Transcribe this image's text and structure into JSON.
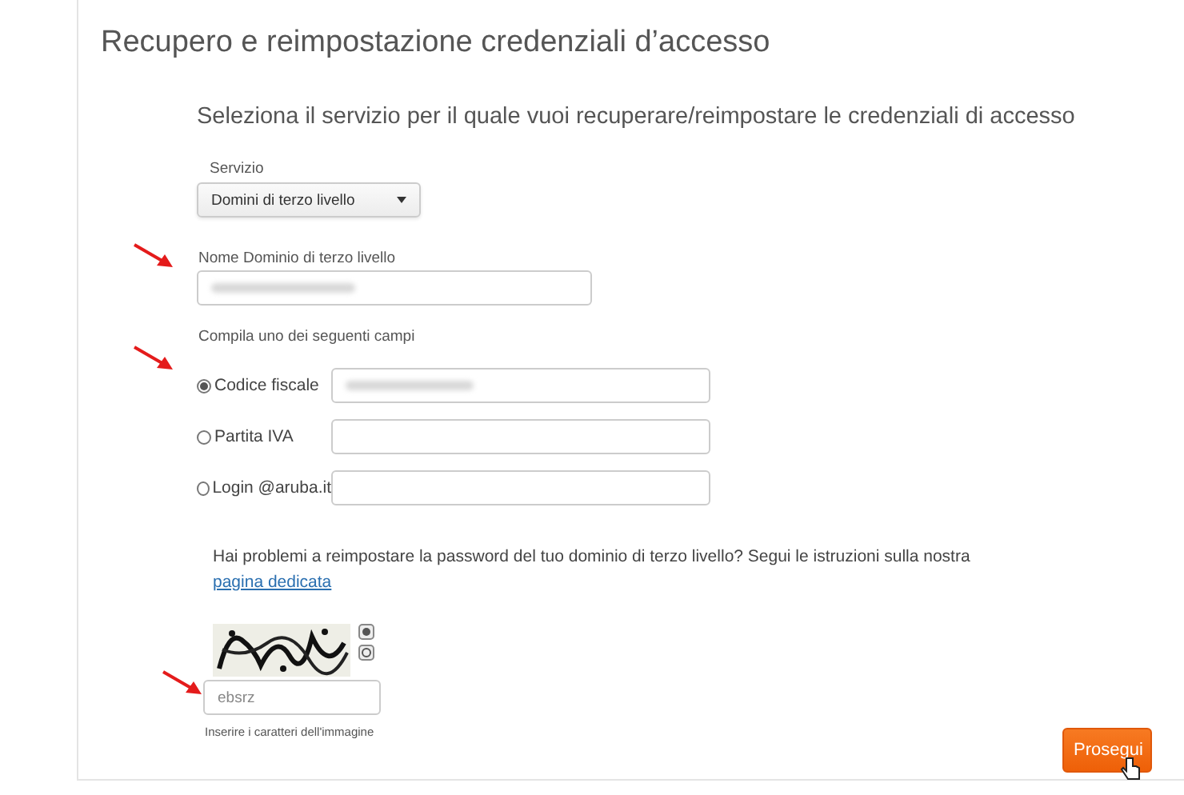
{
  "title": "Recupero e reimpostazione credenziali d’accesso",
  "subtitle": "Seleziona il servizio per il quale vuoi recuperare/reimpostare le credenziali di accesso",
  "service": {
    "label": "Servizio",
    "value": "Domini di terzo livello"
  },
  "domain_field": {
    "label": "Nome Dominio di terzo livello",
    "redacted": true
  },
  "options_label": "Compila uno dei seguenti campi",
  "options": [
    {
      "label": "Codice fiscale",
      "selected": true,
      "redacted": true
    },
    {
      "label": "Partita IVA",
      "selected": false,
      "redacted": false
    },
    {
      "label": "Login @aruba.it",
      "selected": false,
      "redacted": false
    }
  ],
  "help": {
    "text": "Hai problemi a reimpostare la password del tuo dominio di terzo livello? Segui le istruzioni sulla nostra ",
    "link": "pagina dedicata"
  },
  "captcha": {
    "kind": "picture",
    "value": "ebsrz",
    "hint": "Inserire i caratteri dell'immagine"
  },
  "submit": "Prosegui"
}
